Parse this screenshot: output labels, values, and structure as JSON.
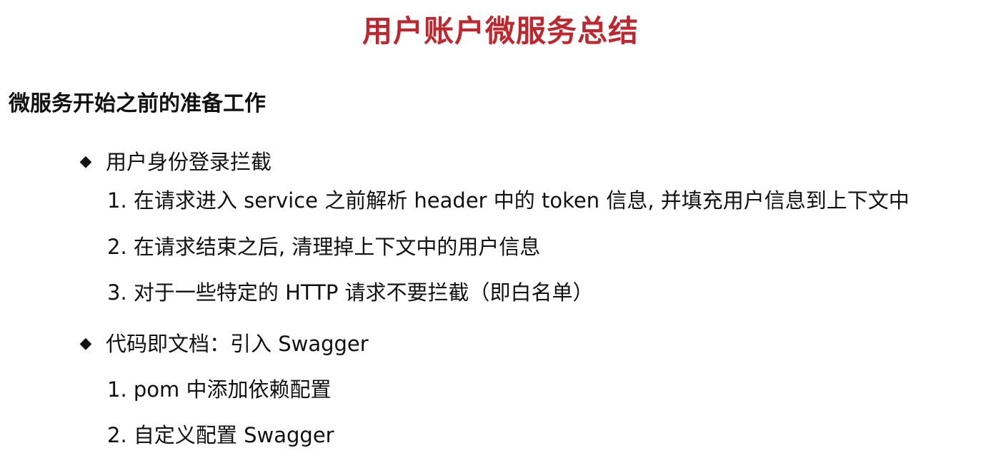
{
  "title": "用户账户微服务总结",
  "section": {
    "heading": "微服务开始之前的准备工作"
  },
  "bullet_icon": "diamond-icon",
  "bullets": [
    {
      "label": "用户身份登录拦截",
      "items": [
        "1. 在请求进入 service 之前解析 header 中的 token 信息, 并填充用户信息到上下文中",
        "2. 在请求结束之后, 清理掉上下文中的用户信息",
        "3. 对于一些特定的 HTTP 请求不要拦截（即白名单）"
      ]
    },
    {
      "label": "代码即文档：引入 Swagger",
      "items": [
        "1. pom 中添加依赖配置",
        "2. 自定义配置 Swagger"
      ]
    }
  ]
}
